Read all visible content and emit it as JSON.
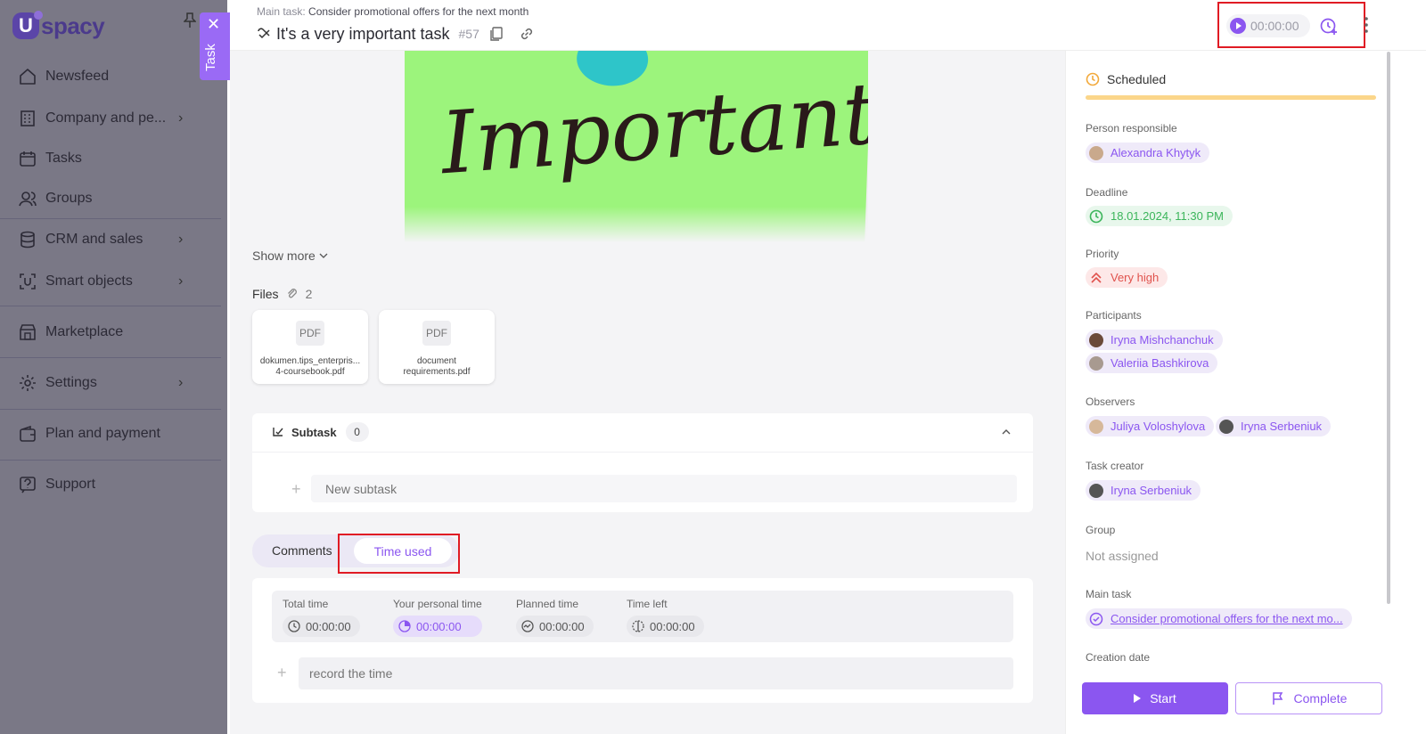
{
  "sidebar": {
    "logo_text": "spacy",
    "items": [
      {
        "label": "Newsfeed",
        "icon": "home-icon"
      },
      {
        "label": "Company and pe...",
        "icon": "building-icon"
      },
      {
        "label": "Tasks",
        "icon": "calendar-icon"
      },
      {
        "label": "Groups",
        "icon": "users-icon"
      },
      {
        "label": "CRM and sales",
        "icon": "database-icon"
      },
      {
        "label": "Smart objects",
        "icon": "smart-object-icon"
      },
      {
        "label": "Marketplace",
        "icon": "store-icon"
      },
      {
        "label": "Settings",
        "icon": "gear-icon"
      },
      {
        "label": "Plan and payment",
        "icon": "wallet-icon"
      },
      {
        "label": "Support",
        "icon": "help-icon"
      }
    ]
  },
  "task_tab": {
    "label": "Task"
  },
  "header": {
    "main_task_prefix": "Main task:",
    "main_task_name": "Consider promotional offers for the next month",
    "title": "It's a very important task",
    "number": "#57",
    "timer": "00:00:00"
  },
  "content": {
    "image_word": "Important",
    "show_more": "Show more",
    "files_label": "Files",
    "files_count": "2",
    "files": [
      {
        "type": "PDF",
        "name": "dokumen.tips_enterpris... 4-coursebook.pdf"
      },
      {
        "type": "PDF",
        "name": "document requirements.pdf"
      }
    ],
    "subtask_label": "Subtask",
    "subtask_count": "0",
    "new_subtask_placeholder": "New subtask",
    "tabs": {
      "comments": "Comments",
      "time_used": "Time used"
    },
    "time": {
      "total_label": "Total time",
      "total": "00:00:00",
      "personal_label": "Your personal time",
      "personal": "00:00:00",
      "planned_label": "Planned time",
      "planned": "00:00:00",
      "left_label": "Time left",
      "left": "00:00:00"
    },
    "record_placeholder": "record the time"
  },
  "panel": {
    "status": "Scheduled",
    "person_label": "Person responsible",
    "person": "Alexandra Khytyk",
    "deadline_label": "Deadline",
    "deadline": "18.01.2024, 11:30 PM",
    "priority_label": "Priority",
    "priority": "Very high",
    "participants_label": "Participants",
    "participants": [
      "Iryna Mishchanchuk",
      "Valeriia Bashkirova"
    ],
    "observers_label": "Observers",
    "observers": [
      "Juliya Voloshylova",
      "Iryna Serbeniuk"
    ],
    "creator_label": "Task creator",
    "creator": "Iryna Serbeniuk",
    "group_label": "Group",
    "group": "Not assigned",
    "main_task_label": "Main task",
    "main_task": "Consider promotional offers for the next mo...",
    "creation_label": "Creation date",
    "start_btn": "Start",
    "complete_btn": "Complete"
  },
  "colors": {
    "accent": "#8b56f0",
    "highlight": "#e01b24"
  }
}
